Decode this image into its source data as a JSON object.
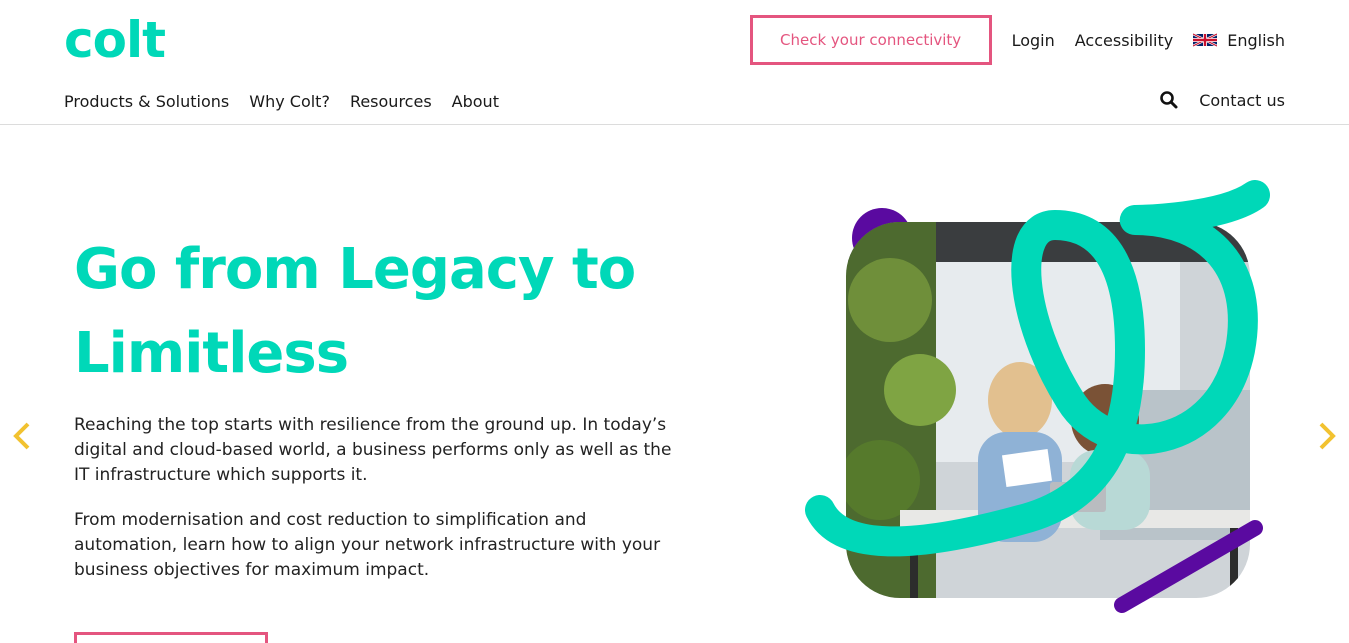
{
  "brand": {
    "logo_text": "colt",
    "accent": "#00d8b8",
    "cta_color": "#e4557f",
    "arrow_color": "#f2c230",
    "purple": "#5a0aa0"
  },
  "header": {
    "cta_label": "Check your connectivity",
    "login_label": "Login",
    "accessibility_label": "Accessibility",
    "language_label": "English",
    "flag_icon": "uk-flag-icon"
  },
  "nav": {
    "items": [
      "Products & Solutions",
      "Why Colt?",
      "Resources",
      "About"
    ],
    "search_icon": "search-icon",
    "contact_label": "Contact us"
  },
  "hero": {
    "title": "Go from Legacy to Limitless",
    "paragraph1": "Reaching the top starts with resilience from the ground up. In today’s digital and cloud-based world, a business performs only as well as the IT infrastructure which supports it.",
    "paragraph2": "From modernisation and cost reduction to simplification and automation, learn how to align your network infrastructure with your business objectives for maximum impact.",
    "prev_icon": "chevron-left-icon",
    "next_icon": "chevron-right-icon"
  }
}
